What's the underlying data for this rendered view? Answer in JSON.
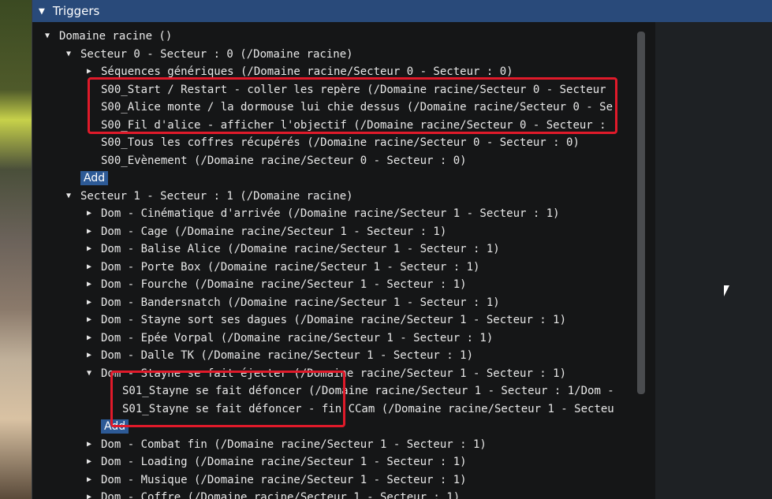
{
  "window": {
    "title": "Triggers",
    "collapse_icon": "triangle-down-icon"
  },
  "tree": {
    "root": "Domaine racine ()",
    "sector0": {
      "label": "Secteur 0 - Secteur : 0 (/Domaine racine)",
      "generic": "Séquences génériques (/Domaine racine/Secteur 0 - Secteur : 0)",
      "items": [
        "S00_Start / Restart - coller les repère (/Domaine racine/Secteur 0 - Secteur",
        "S00_Alice monte / la dormouse lui chie dessus (/Domaine racine/Secteur 0 - Se",
        "S00_Fil d'alice - afficher l'objectif (/Domaine racine/Secteur 0 - Secteur : ",
        "S00_Tous les coffres récupérés (/Domaine racine/Secteur 0 - Secteur : 0)",
        "S00_Evènement (/Domaine racine/Secteur 0 - Secteur : 0)"
      ],
      "add_label": "Add"
    },
    "sector1": {
      "label": "Secteur 1 - Secteur : 1 (/Domaine racine)",
      "items": [
        "Dom - Cinématique d'arrivée (/Domaine racine/Secteur 1 - Secteur : 1)",
        "Dom - Cage (/Domaine racine/Secteur 1 - Secteur : 1)",
        "Dom - Balise Alice (/Domaine racine/Secteur 1 - Secteur : 1)",
        "Dom - Porte Box (/Domaine racine/Secteur 1 - Secteur : 1)",
        "Dom - Fourche (/Domaine racine/Secteur 1 - Secteur : 1)",
        "Dom - Bandersnatch (/Domaine racine/Secteur 1 - Secteur : 1)",
        "Dom - Stayne sort ses dagues (/Domaine racine/Secteur 1 - Secteur : 1)",
        "Dom - Epée Vorpal (/Domaine racine/Secteur 1 - Secteur : 1)",
        "Dom - Dalle TK (/Domaine racine/Secteur 1 - Secteur : 1)"
      ],
      "expanded_item": "Dom - Stayne se fait éjecter (/Domaine racine/Secteur 1 - Secteur : 1)",
      "expanded_children": [
        "S01_Stayne se fait défoncer (/Domaine racine/Secteur 1 - Secteur : 1/Dom - ",
        "S01_Stayne se fait défoncer - fin CCam (/Domaine racine/Secteur 1 - Secteu"
      ],
      "expanded_add_label": "Add",
      "items_after": [
        "Dom - Combat fin (/Domaine racine/Secteur 1 - Secteur : 1)",
        "Dom - Loading (/Domaine racine/Secteur 1 - Secteur : 1)",
        "Dom - Musique (/Domaine racine/Secteur 1 - Secteur : 1)",
        "Dom - Coffre (/Domaine racine/Secteur 1 - Secteur : 1)"
      ]
    }
  },
  "colors": {
    "titlebar": "#294a7a",
    "highlight": "#e01a2a",
    "add_button": "#2d5a96"
  }
}
